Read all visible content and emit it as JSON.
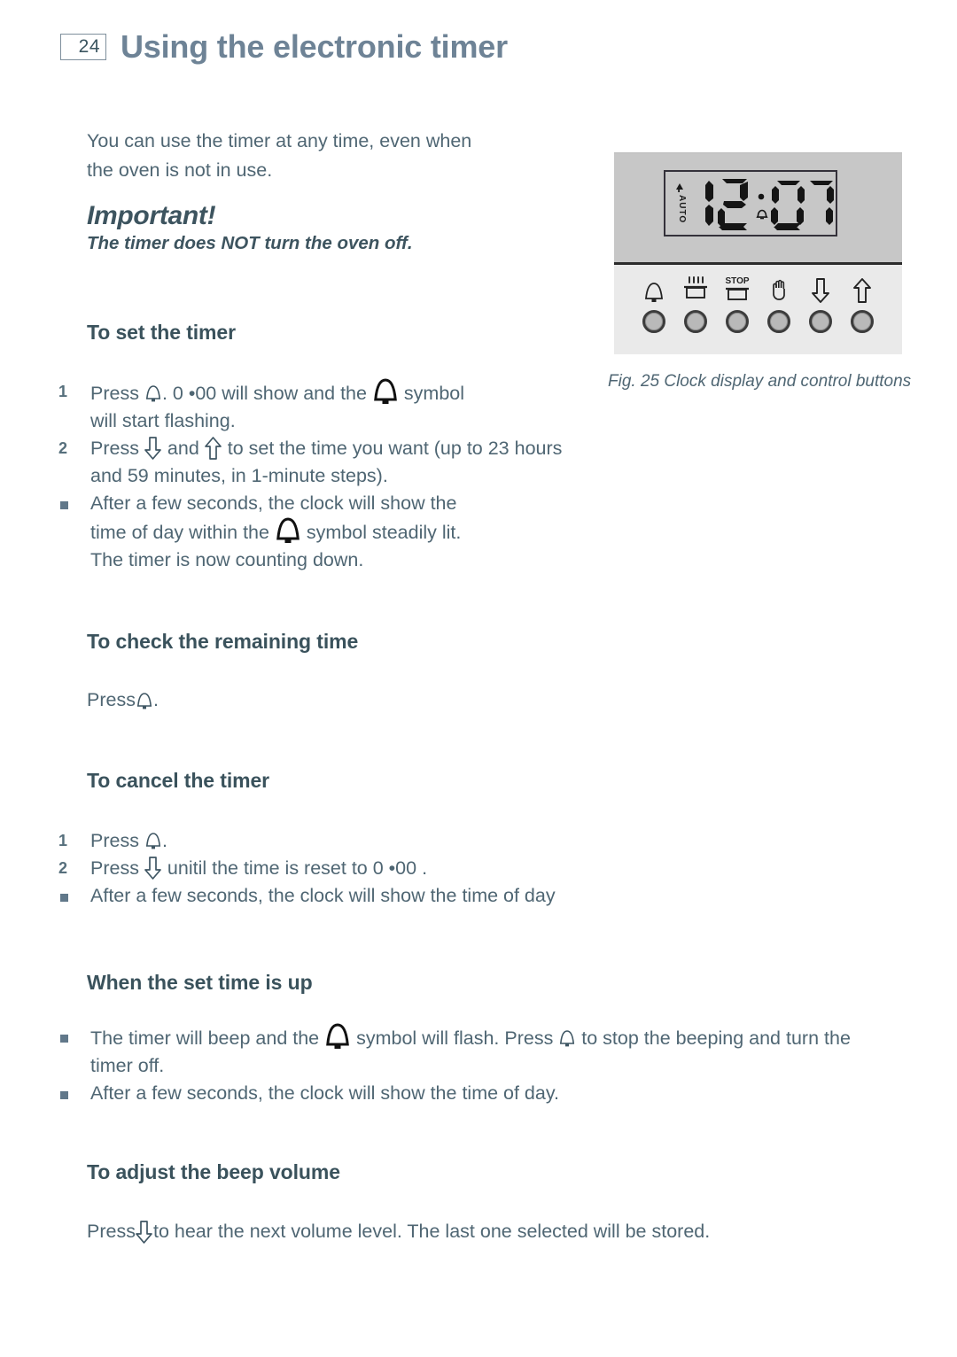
{
  "header": {
    "page_number": "24",
    "title": "Using the electronic timer"
  },
  "intro": {
    "text": "You can use the timer at any time, even when the oven is not in use.",
    "important_title": "Important!",
    "important_sub": "The timer does NOT turn the oven off."
  },
  "sections": {
    "set_timer": {
      "heading": "To set the timer",
      "steps": [
        {
          "marker": "1",
          "parts": [
            "Press ",
            "bell-outline-icon",
            ". 0 •00   will show and the ",
            "bell-solid-icon",
            " symbol will start flashing."
          ]
        },
        {
          "marker": "2",
          "parts": [
            "Press ",
            "arrow-down-icon",
            " and ",
            "arrow-up-icon",
            " to set the time you want (up to 23 hours and 59 minutes, in 1-minute steps)."
          ]
        },
        {
          "marker": "■",
          "parts": [
            "After a few seconds, the clock will show the time of day within the ",
            "bell-solid-icon",
            "  symbol steadily lit. The timer is now counting down."
          ]
        }
      ],
      "step1_a": "Press ",
      "step1_b": ". 0 •00   will show and the ",
      "step1_c": " symbol",
      "step1_d": "will start flashing.",
      "step2_a": "Press ",
      "step2_b": " and ",
      "step2_c": " to set the time you want (up to 23 hours",
      "step2_d": "and 59 minutes, in 1-minute steps).",
      "step3_a": "After a few seconds, the clock will show the",
      "step3_b": "time of day within the ",
      "step3_c": "  symbol steadily lit.",
      "step3_d": "The timer is now counting down."
    },
    "check_time": {
      "heading": "To check the remaining time",
      "press_label": "Press ",
      "period": "."
    },
    "cancel_timer": {
      "heading": "To cancel the timer",
      "step1_marker": "1",
      "step1_a": "Press ",
      "step1_b": ".",
      "step2_marker": "2",
      "step2_a": "Press ",
      "step2_b": " unitil the time is reset to 0 •00  .",
      "step3_text": "After a few seconds, the clock will show the time of day"
    },
    "time_up": {
      "heading": "When the set time is up",
      "b1_a": "The timer will beep and the ",
      "b1_b": " symbol will flash. Press ",
      "b1_c": " to stop the beeping and turn the",
      "b1_d": "timer off.",
      "b2_text": "After a few seconds, the clock will show the time of day."
    },
    "beep_volume": {
      "heading": "To adjust the beep volume",
      "press_a": "Press ",
      "press_b": " to hear the next volume level. The last one selected will be stored."
    }
  },
  "figure": {
    "caption": "Fig. 25 Clock display and control buttons",
    "lcd": {
      "auto_label": "AUTO",
      "time": "12:07",
      "hours": "12",
      "minutes": "07"
    },
    "buttons": [
      {
        "name": "bell-button",
        "label": ""
      },
      {
        "name": "cook-time-button",
        "label": ""
      },
      {
        "name": "stop-time-button",
        "label": "STOP"
      },
      {
        "name": "manual-hand-button",
        "label": ""
      },
      {
        "name": "decrease-button",
        "label": ""
      },
      {
        "name": "increase-button",
        "label": ""
      }
    ]
  },
  "colors": {
    "title": "#6e8396",
    "heading": "#3a525c",
    "body": "#4f6673",
    "panel_top": "#c7c7c7",
    "panel_bottom": "#eaeaea"
  }
}
